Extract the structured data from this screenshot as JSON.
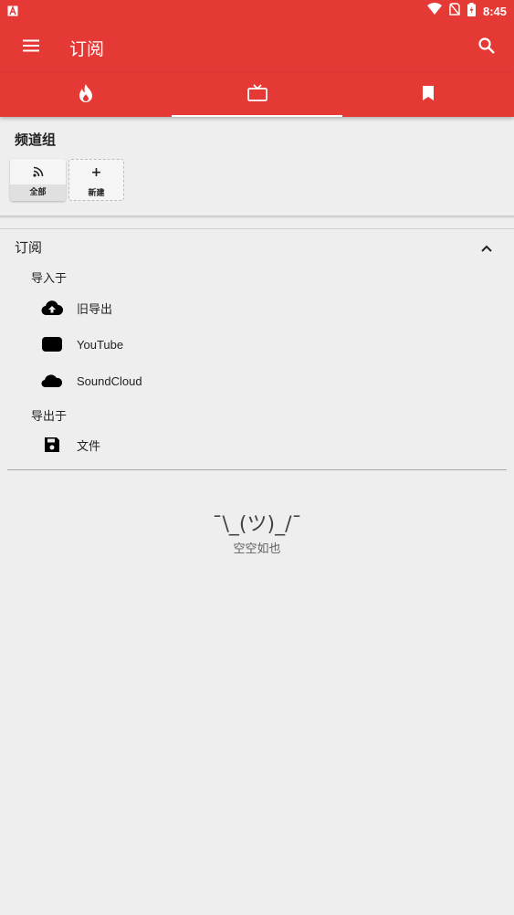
{
  "status_bar": {
    "time": "8:45",
    "left_icon": "notification-a-icon",
    "icons": [
      "wifi-icon",
      "no-sim-icon",
      "battery-charging-icon"
    ]
  },
  "toolbar": {
    "title": "订阅",
    "menu_icon": "menu-icon",
    "search_icon": "search-icon"
  },
  "tabs": [
    {
      "icon": "fire-icon",
      "active": false
    },
    {
      "icon": "tv-icon",
      "active": true
    },
    {
      "icon": "bookmark-icon",
      "active": false
    }
  ],
  "channel_groups": {
    "title": "频道组",
    "items": [
      {
        "label": "全部",
        "icon": "rss-icon"
      },
      {
        "label": "新建",
        "icon": "plus-icon",
        "glyph": "+"
      }
    ]
  },
  "subscriptions": {
    "title": "订阅",
    "import_label": "导入于",
    "import_items": [
      {
        "label": "旧导出",
        "icon": "cloud-upload-icon"
      },
      {
        "label": "YouTube",
        "icon": "youtube-icon"
      },
      {
        "label": "SoundCloud",
        "icon": "soundcloud-icon"
      }
    ],
    "export_label": "导出于",
    "export_items": [
      {
        "label": "文件",
        "icon": "save-icon"
      }
    ]
  },
  "empty_state": {
    "face": "¯\\_(ツ)_/¯",
    "message": "空空如也"
  },
  "colors": {
    "primary": "#e53935",
    "background": "#eeeeee"
  }
}
